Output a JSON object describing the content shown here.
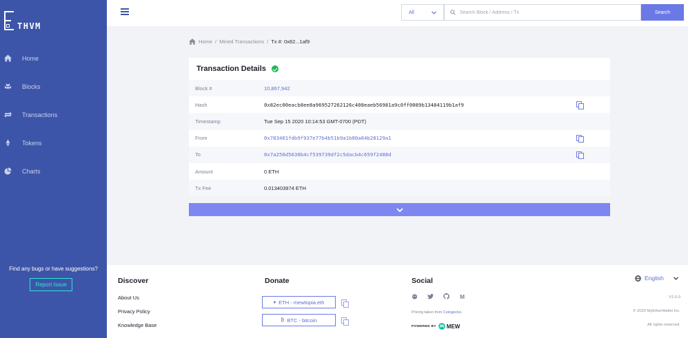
{
  "brand": {
    "logo_text": "THVM"
  },
  "sidebar": {
    "items": [
      {
        "label": "Home",
        "icon": "home-icon"
      },
      {
        "label": "Blocks",
        "icon": "blocks-icon"
      },
      {
        "label": "Transactions",
        "icon": "transfer-icon"
      },
      {
        "label": "Tokens",
        "icon": "ethereum-icon"
      },
      {
        "label": "Charts",
        "icon": "pie-chart-icon"
      }
    ],
    "bug_text": "Find any bugs or have suggestions?",
    "report_label": "Report Issue"
  },
  "header": {
    "filter_value": "All",
    "search_placeholder": "Search Block / Address / Tx",
    "search_label": "Search"
  },
  "breadcrumb": {
    "home": "Home",
    "mined": "Mined Transactions",
    "current": "Tx #: 0x82...1af9"
  },
  "details": {
    "title": "Transaction Details",
    "status": "success",
    "rows": [
      {
        "key": "Block #",
        "value": "10,867,942"
      },
      {
        "key": "Hash",
        "value": "0x82ec00eacb8ee8a969527262126c408eaeb56981a9c0ff0089b13484119b1af9"
      },
      {
        "key": "Timestamp",
        "value": "Tue Sep 15 2020 10:14:53 GMT-0700 (PDT)"
      },
      {
        "key": "From",
        "value": "0x783401fdb9f937e77b4b51b9a1b00a64b28129a1"
      },
      {
        "key": "To",
        "value": "0x7a250d5630b4cf539739df2c5dacb4c659f2488d"
      },
      {
        "key": "Amount",
        "value": "0 ETH"
      },
      {
        "key": "Tx Fee",
        "value": "0.013403974 ETH"
      }
    ]
  },
  "footer": {
    "discover_title": "Discover",
    "discover_links": [
      "About Us",
      "Privacy Policy",
      "Knowledge Base"
    ],
    "donate_title": "Donate",
    "donate_eth": "ETH - mewtopia.eth",
    "donate_btc": "BTC - bitcoin",
    "social_title": "Social",
    "social_icons": [
      "reddit-icon",
      "twitter-icon",
      "github-icon",
      "medium-icon"
    ],
    "medium_glyph": "M",
    "pricing_text": "Pricing taken from ",
    "pricing_link": "Coingecko.",
    "powered_by": "POWERED BY",
    "mew_label": "MEW",
    "language": "English",
    "version": "V1.0.0",
    "copyright": "© 2020 MyEtherWallet Inc.",
    "rights": "All rights reserved."
  },
  "colors": {
    "sidebar": "#3d55a8",
    "accent": "#6b79e6",
    "link": "#5f6ed2",
    "report_border": "#2ee6d6",
    "success": "#1fb55a",
    "expand_bar": "#7e86ef"
  }
}
